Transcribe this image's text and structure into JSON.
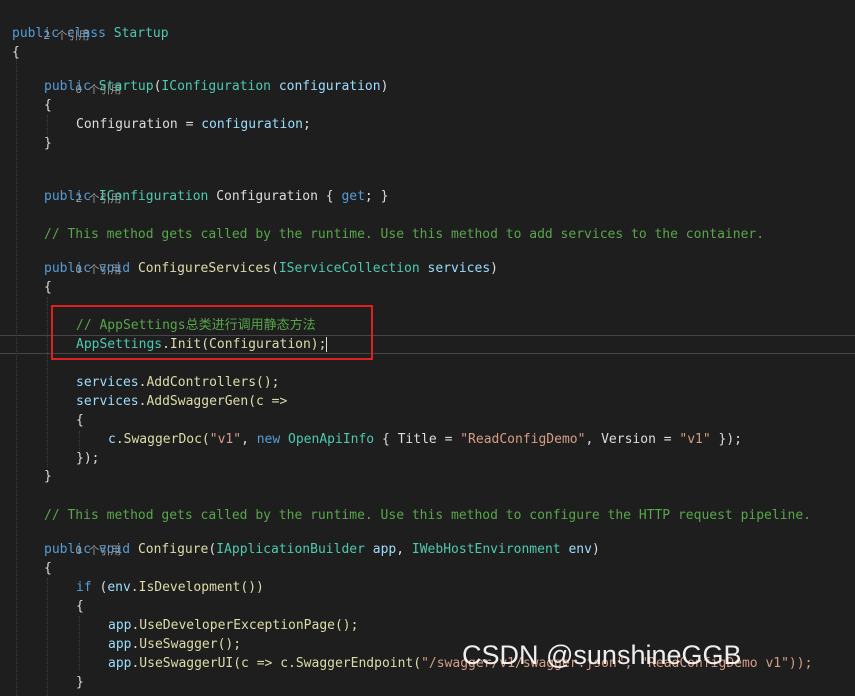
{
  "colors": {
    "background": "#1e1e1e",
    "keyword": "#569cd6",
    "type": "#4ec9b0",
    "identifier": "#9cdcfe",
    "method": "#dcdcaa",
    "string": "#d69d85",
    "comment": "#57a64a",
    "highlight_box": "#e02020"
  },
  "code": {
    "refs": {
      "class": "2 个引用",
      "ctor": "0 个引用",
      "prop": "2 个引用",
      "configure_services": "0 个引用",
      "configure": "0 个引用"
    },
    "l_class": {
      "kw1": "public",
      "kw2": "class",
      "name": "Startup"
    },
    "open_brace": "{",
    "close_brace": "}",
    "l_ctor": {
      "kw": "public",
      "name": "Startup",
      "p1": "(",
      "type": "IConfiguration",
      "param": "configuration",
      "p2": ")"
    },
    "l_assign": {
      "lhs": "Configuration = ",
      "rhs": "configuration",
      "end": ";"
    },
    "l_prop": {
      "kw": "public",
      "type": "IConfiguration",
      "name": " Configuration { ",
      "get": "get",
      "end": "; }"
    },
    "comment_services": "// This method gets called by the runtime. Use this method to add services to the container.",
    "l_cs": {
      "kw1": "public",
      "kw2": "void",
      "name": "ConfigureServices",
      "p1": "(",
      "type": "IServiceCollection",
      "param": "services",
      "p2": ")"
    },
    "comment_appsettings": "// AppSettings总类进行调用静态方法",
    "l_init": {
      "type": "AppSettings",
      "rest": ".Init(Configuration);"
    },
    "l_addctrl": {
      "obj": "services",
      "call": ".AddControllers();"
    },
    "l_addsw": {
      "obj": "services",
      "call": ".AddSwaggerGen(c =>"
    },
    "l_swdoc": {
      "obj": "c",
      "method": ".SwaggerDoc(",
      "s1": "\"v1\"",
      "sep": ", ",
      "kwnew": "new",
      "type": "OpenApiInfo",
      "t1": " { Title = ",
      "s2": "\"ReadConfigDemo\"",
      "t2": ", Version = ",
      "s3": "\"v1\"",
      "t3": " });"
    },
    "l_close_lambda": "});",
    "comment_configure": "// This method gets called by the runtime. Use this method to configure the HTTP request pipeline.",
    "l_cfg": {
      "kw1": "public",
      "kw2": "void",
      "name": "Configure",
      "p1": "(",
      "type1": "IApplicationBuilder",
      "param1": "app",
      "sep": ", ",
      "type2": "IWebHostEnvironment",
      "param2": "env",
      "p2": ")"
    },
    "l_if": {
      "kw": "if",
      "p1": " (",
      "obj": "env",
      "call": ".IsDevelopment())"
    },
    "l_dev": {
      "obj": "app",
      "call": ".UseDeveloperExceptionPage();"
    },
    "l_sw": {
      "obj": "app",
      "call": ".UseSwagger();"
    },
    "l_swui": {
      "obj": "app",
      "call": ".UseSwaggerUI(c => c.SwaggerEndpoint(",
      "str": "\"/swagger/v1/swagger.json\", \"ReadConfigDemo v1\"));"
    }
  },
  "watermark": "CSDN @sunshineGGB"
}
